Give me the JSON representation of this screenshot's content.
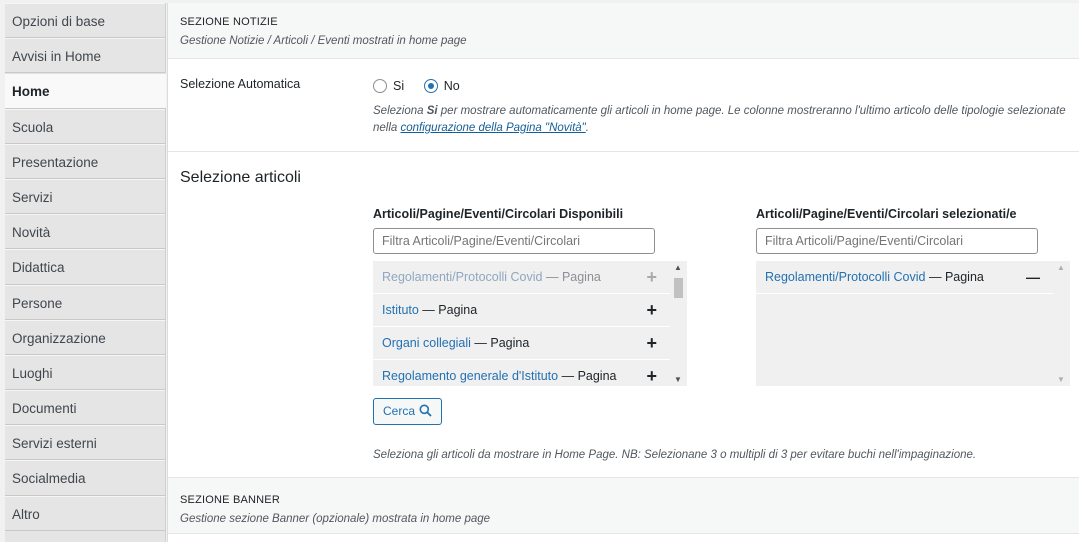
{
  "sidebar": {
    "items": [
      {
        "label": "Opzioni di base"
      },
      {
        "label": "Avvisi in Home"
      },
      {
        "label": "Home"
      },
      {
        "label": "Scuola"
      },
      {
        "label": "Presentazione"
      },
      {
        "label": "Servizi"
      },
      {
        "label": "Novità"
      },
      {
        "label": "Didattica"
      },
      {
        "label": "Persone"
      },
      {
        "label": "Organizzazione"
      },
      {
        "label": "Luoghi"
      },
      {
        "label": "Documenti"
      },
      {
        "label": "Servizi esterni"
      },
      {
        "label": "Socialmedia"
      },
      {
        "label": "Altro"
      }
    ]
  },
  "news": {
    "title": "SEZIONE NOTIZIE",
    "desc": "Gestione Notizie / Articoli / Eventi mostrati in home page",
    "auto_label": "Selezione Automatica",
    "radio_yes": "Si",
    "radio_no": "No",
    "help_pre": "Seleziona ",
    "help_bold": "Si",
    "help_mid": " per mostrare automaticamente gli articoli in home page. Le colonne mostreranno l'ultimo articolo delle tipologie selezionate nella ",
    "help_link": "configurazione della Pagina \"Novità\"",
    "help_end": ".",
    "select_title": "Selezione articoli",
    "available_title": "Articoli/Pagine/Eventi/Circolari Disponibili",
    "selected_title": "Articoli/Pagine/Eventi/Circolari selezionati/e",
    "filter_placeholder": "Filtra Articoli/Pagine/Eventi/Circolari",
    "available": [
      {
        "title": "Regolamenti/Protocolli Covid",
        "type": " — Pagina",
        "action": "+"
      },
      {
        "title": "Istituto",
        "type": " — Pagina",
        "action": "+"
      },
      {
        "title": "Organi collegiali",
        "type": " — Pagina",
        "action": "+"
      },
      {
        "title": "Regolamento generale d'Istituto",
        "type": " — Pagina",
        "action": "+"
      }
    ],
    "selected": [
      {
        "title": "Regolamenti/Protocolli Covid",
        "type": " — Pagina",
        "action": "—"
      }
    ],
    "search_btn": "Cerca",
    "bottom_help": "Seleziona gli articoli da mostrare in Home Page. NB: Selezionane 3 o multipli di 3 per evitare buchi nell'impaginazione."
  },
  "banner": {
    "title": "SEZIONE BANNER",
    "desc": "Gestione sezione Banner (opzionale) mostrata in home page"
  }
}
